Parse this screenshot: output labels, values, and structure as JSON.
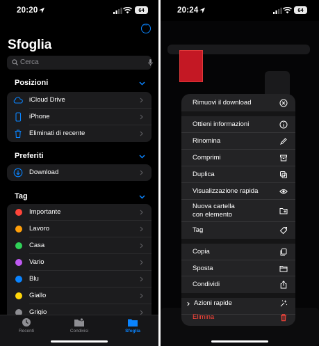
{
  "left_screen": {
    "status": {
      "time": "20:20",
      "battery": "64"
    },
    "title": "Sfoglia",
    "search": {
      "placeholder": "Cerca"
    },
    "sections": {
      "locations": {
        "header": "Posizioni",
        "items": [
          {
            "label": "iCloud Drive",
            "icon": "cloud-icon"
          },
          {
            "label": "iPhone",
            "icon": "phone-icon"
          },
          {
            "label": "Eliminati di recente",
            "icon": "trash-icon"
          }
        ]
      },
      "favorites": {
        "header": "Preferiti",
        "items": [
          {
            "label": "Download",
            "icon": "download-icon"
          }
        ]
      },
      "tags": {
        "header": "Tag",
        "items": [
          {
            "label": "Importante",
            "color": "#ff453a"
          },
          {
            "label": "Lavoro",
            "color": "#ff9f0a"
          },
          {
            "label": "Casa",
            "color": "#30d158"
          },
          {
            "label": "Vario",
            "color": "#bf5af2"
          },
          {
            "label": "Blu",
            "color": "#0a84ff"
          },
          {
            "label": "Giallo",
            "color": "#ffd60a"
          },
          {
            "label": "Grigio",
            "color": "#8e8e93"
          }
        ]
      }
    },
    "tabbar": [
      {
        "label": "Recenti",
        "icon": "clock-icon",
        "active": false
      },
      {
        "label": "Condivisi",
        "icon": "shared-folder-icon",
        "active": false
      },
      {
        "label": "Sfoglia",
        "icon": "folder-icon",
        "active": true
      }
    ],
    "accent_color": "#0a84ff"
  },
  "right_screen": {
    "status": {
      "time": "20:24",
      "battery": "64"
    },
    "context_menu": {
      "items": [
        {
          "label": "Rimuovi il download",
          "icon": "remove-download-icon"
        },
        {
          "label": "Ottieni informazioni",
          "icon": "info-icon"
        },
        {
          "label": "Rinomina",
          "icon": "pencil-icon"
        },
        {
          "label": "Comprimi",
          "icon": "archive-icon"
        },
        {
          "label": "Duplica",
          "icon": "duplicate-icon"
        },
        {
          "label": "Visualizzazione rapida",
          "icon": "eye-icon"
        },
        {
          "label": "Nuova cartella\ncon elemento",
          "icon": "new-folder-icon"
        },
        {
          "label": "Tag",
          "icon": "tag-icon"
        },
        {
          "label": "Copia",
          "icon": "copy-icon"
        },
        {
          "label": "Sposta",
          "icon": "move-folder-icon"
        },
        {
          "label": "Condividi",
          "icon": "share-icon"
        },
        {
          "label": "Azioni rapide",
          "icon": "sparkle-icon"
        },
        {
          "label": "Elimina",
          "icon": "trash-icon",
          "destructive": true
        }
      ]
    },
    "destructive_color": "#ff453a"
  }
}
